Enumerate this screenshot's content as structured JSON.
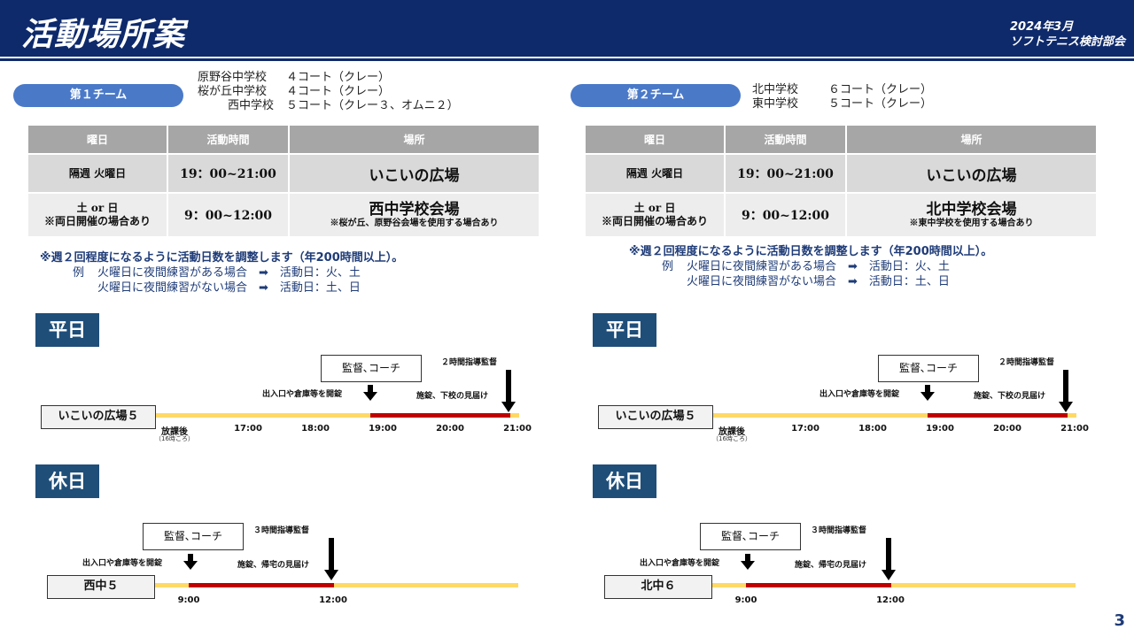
{
  "header": {
    "title": "活動場所案",
    "date": "2024年3月",
    "dept": "ソフトテニス検討部会"
  },
  "table_headers": [
    "曜日",
    "活動時間",
    "場所"
  ],
  "teams": [
    {
      "name": "第１チーム",
      "courts": [
        {
          "school": "原野谷中学校",
          "count": "４コート（クレー）"
        },
        {
          "school": "桜が丘中学校",
          "count": "４コート（クレー）"
        },
        {
          "school": "西中学校",
          "count": "５コート（クレー３、オムニ２）"
        }
      ],
      "rows": [
        {
          "day": "隔週 火曜日",
          "day2": "",
          "time": "19：00~21:00",
          "place": "いこいの広場",
          "note": ""
        },
        {
          "day": "土 or 日",
          "day2": "※両日開催の場合あり",
          "time": "9：00~12:00",
          "place": "西中学校会場",
          "note": "※桜が丘、原野谷会場を使用する場合あり"
        }
      ],
      "notes": {
        "main": "※週２回程度になるように活動日数を調整します（年200時間以上）。",
        "ex_prefix": "例",
        "ex1": "火曜日に夜間練習がある場合　➡　活動日：火、土",
        "ex2": "火曜日に夜間練習がない場合　➡　活動日：土、日"
      },
      "weekday": {
        "label": "平日",
        "location": "いこいの広場５",
        "coach": "監督､コーチ",
        "guidance": "２時間指導監督",
        "open": "出入口や倉庫等を開錠",
        "close": "施錠、下校の見届け",
        "ticks": [
          "放課後",
          "17:00",
          "18:00",
          "19:00",
          "20:00",
          "21:00"
        ],
        "tick_sub": "（16時ころ）"
      },
      "holiday": {
        "label": "休日",
        "location": "西中５",
        "coach": "監督､コーチ",
        "guidance": "３時間指導監督",
        "open": "出入口や倉庫等を開錠",
        "close": "施錠、帰宅の見届け",
        "ticks": [
          "9:00",
          "12:00"
        ]
      }
    },
    {
      "name": "第２チーム",
      "courts": [
        {
          "school": "北中学校",
          "count": "６コート（クレー）"
        },
        {
          "school": "東中学校",
          "count": "５コート（クレー）"
        }
      ],
      "rows": [
        {
          "day": "隔週 火曜日",
          "day2": "",
          "time": "19：00~21:00",
          "place": "いこいの広場",
          "note": ""
        },
        {
          "day": "土 or 日",
          "day2": "※両日開催の場合あり",
          "time": "9：00~12:00",
          "place": "北中学校会場",
          "note": "※東中学校を使用する場合あり"
        }
      ],
      "notes": {
        "main": "※週２回程度になるように活動日数を調整します（年200時間以上）。",
        "ex_prefix": "例",
        "ex1": "火曜日に夜間練習がある場合　➡　活動日：火、土",
        "ex2": "火曜日に夜間練習がない場合　➡　活動日：土、日"
      },
      "weekday": {
        "label": "平日",
        "location": "いこいの広場５",
        "coach": "監督､コーチ",
        "guidance": "２時間指導監督",
        "open": "出入口や倉庫等を開錠",
        "close": "施錠、下校の見届け",
        "ticks": [
          "放課後",
          "17:00",
          "18:00",
          "19:00",
          "20:00",
          "21:00"
        ],
        "tick_sub": "（16時ころ）"
      },
      "holiday": {
        "label": "休日",
        "location": "北中６",
        "coach": "監督､コーチ",
        "guidance": "３時間指導監督",
        "open": "出入口や倉庫等を開錠",
        "close": "施錠、帰宅の見届け",
        "ticks": [
          "9:00",
          "12:00"
        ]
      }
    }
  ],
  "page_number": "3"
}
